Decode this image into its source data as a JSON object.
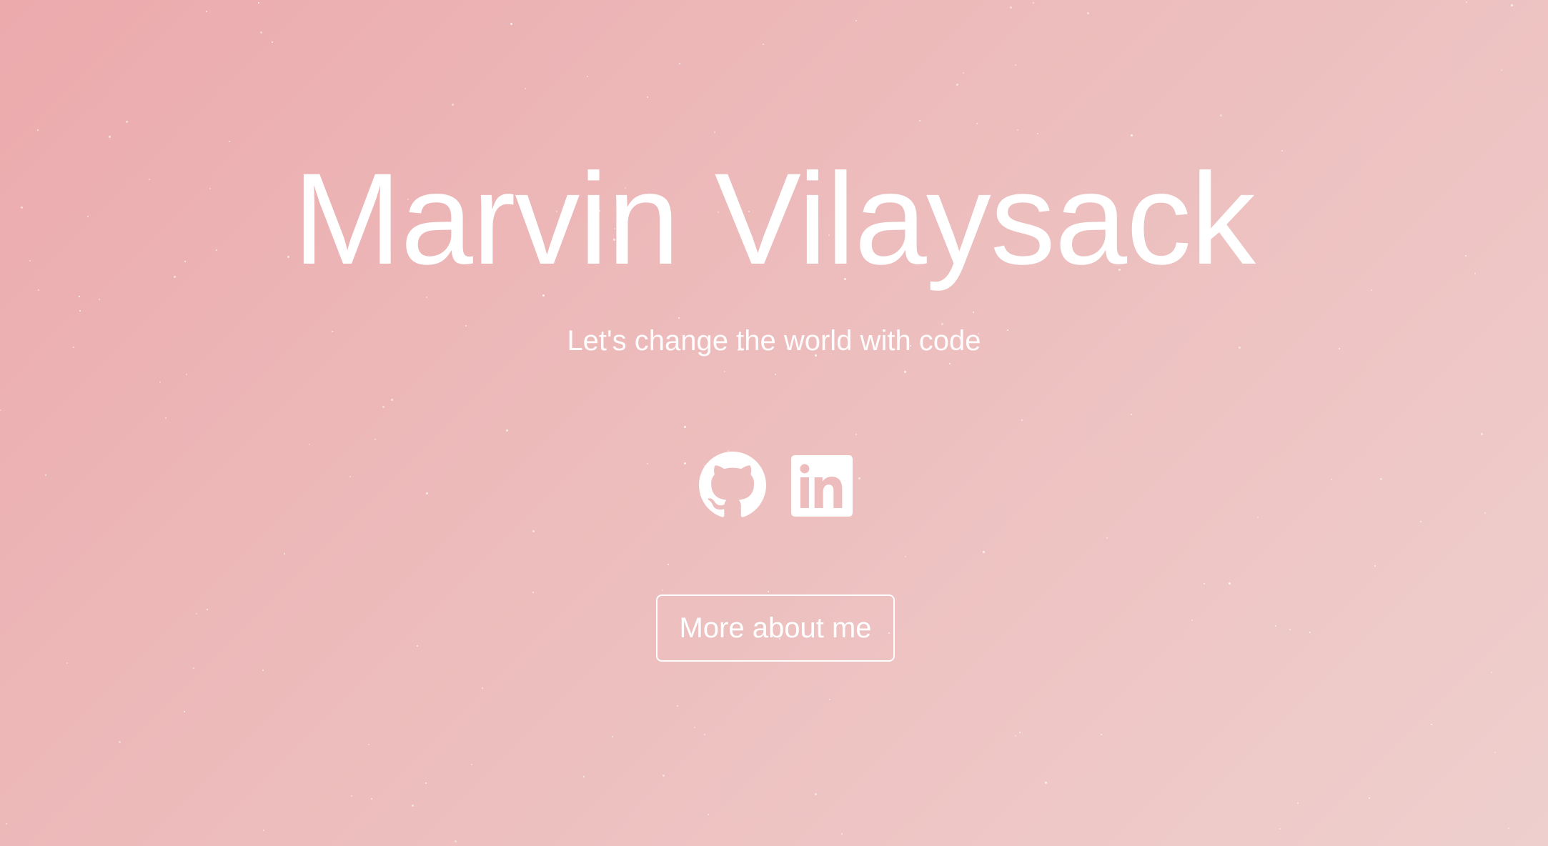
{
  "hero": {
    "name": "Marvin Vilaysack",
    "tagline": "Let's change the world with code"
  },
  "socials": [
    {
      "label": "GitHub",
      "icon": "github-icon"
    },
    {
      "label": "LinkedIn",
      "icon": "linkedin-icon"
    }
  ],
  "cta": {
    "label": "More about me"
  },
  "colors": {
    "background_start": "#ecaaad",
    "background_end": "#eecfcd",
    "foreground": "#ffffff"
  }
}
